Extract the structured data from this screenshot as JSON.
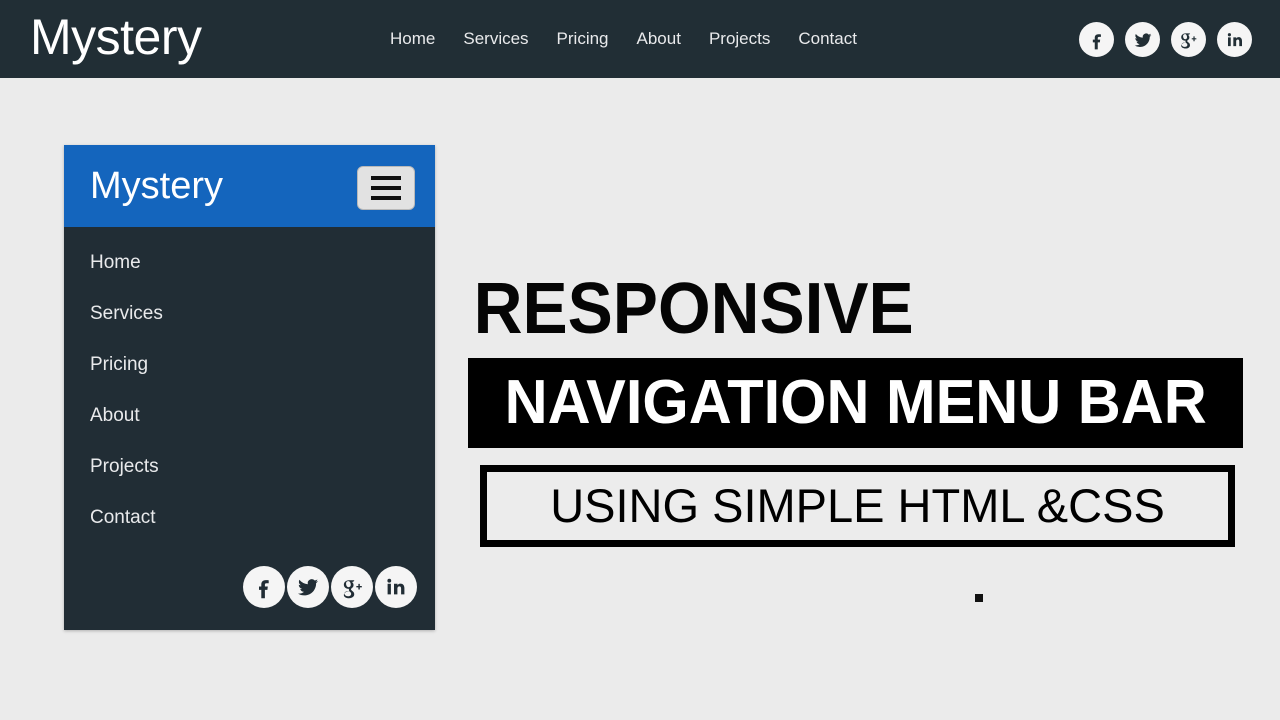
{
  "theme": {
    "topbar_bg": "#212e35",
    "page_bg": "#ebebeb",
    "sidebar_bg": "#212d35",
    "sidebar_header_bg": "#1465bd",
    "accent_black": "#000000",
    "text_light": "#e9eaec"
  },
  "topbar": {
    "logo": "Mystery",
    "nav": [
      {
        "label": "Home"
      },
      {
        "label": "Services"
      },
      {
        "label": "Pricing"
      },
      {
        "label": "About"
      },
      {
        "label": "Projects"
      },
      {
        "label": "Contact"
      }
    ],
    "social": [
      {
        "name": "facebook-icon",
        "label": "Facebook"
      },
      {
        "name": "twitter-icon",
        "label": "Twitter"
      },
      {
        "name": "google-plus-icon",
        "label": "Google Plus"
      },
      {
        "name": "linkedin-icon",
        "label": "LinkedIn"
      }
    ]
  },
  "sidebar": {
    "title": "Mystery",
    "toggle_label": "Menu",
    "menu": [
      {
        "label": "Home"
      },
      {
        "label": "Services"
      },
      {
        "label": "Pricing"
      },
      {
        "label": "About"
      },
      {
        "label": "Projects"
      },
      {
        "label": "Contact"
      }
    ],
    "social": [
      {
        "name": "facebook-icon",
        "label": "Facebook"
      },
      {
        "name": "twitter-icon",
        "label": "Twitter"
      },
      {
        "name": "google-plus-icon",
        "label": "Google Plus"
      },
      {
        "name": "linkedin-icon",
        "label": "LinkedIn"
      }
    ]
  },
  "hero": {
    "line1": "RESPONSIVE",
    "line2": "NAVIGATION MENU BAR",
    "line3": "USING SIMPLE HTML &CSS",
    "dot": "."
  }
}
